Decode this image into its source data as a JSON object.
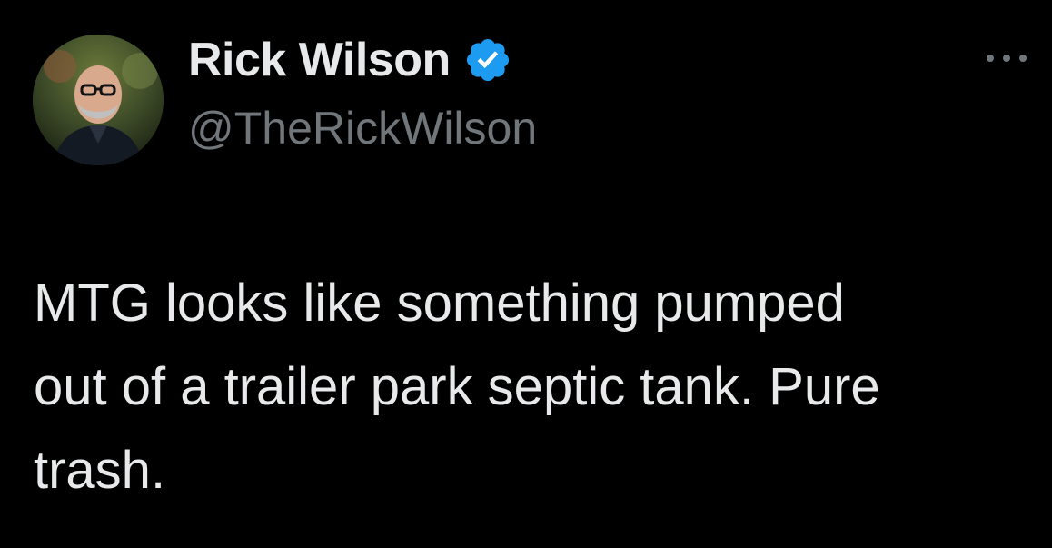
{
  "author": {
    "display_name": "Rick Wilson",
    "handle": "@TheRickWilson",
    "verified": true,
    "verified_color": "#1d9bf0"
  },
  "tweet": {
    "text_lines": [
      "MTG looks like something pumped",
      "out of a trailer park septic tank. Pure",
      "trash."
    ]
  },
  "icons": {
    "more": "more-options-icon",
    "verified": "verified-badge-icon"
  },
  "colors": {
    "background": "#000000",
    "primary_text": "#e7e9ea",
    "secondary_text": "#71767b"
  }
}
